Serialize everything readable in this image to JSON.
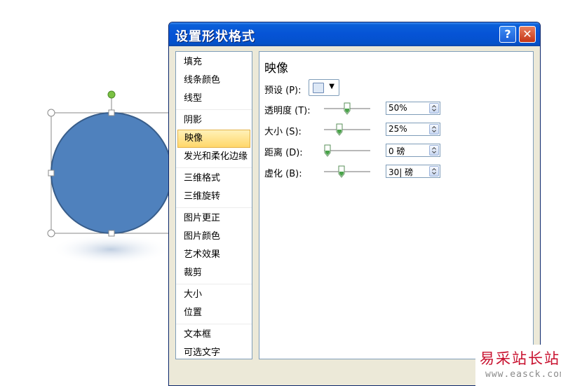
{
  "dialog": {
    "title": "设置形状格式",
    "help_label": "?",
    "close_label": "✕"
  },
  "categories": [
    [
      "填充",
      "线条颜色",
      "线型"
    ],
    [
      "阴影",
      "映像",
      "发光和柔化边缘"
    ],
    [
      "三维格式",
      "三维旋转"
    ],
    [
      "图片更正",
      "图片颜色",
      "艺术效果",
      "裁剪"
    ],
    [
      "大小",
      "位置"
    ],
    [
      "文本框",
      "可选文字"
    ]
  ],
  "active_category": "映像",
  "pane": {
    "title": "映像",
    "preset_label": "预设 (P):",
    "rows": [
      {
        "label": "透明度 (T):",
        "value": "50%",
        "slider_fraction": 0.5
      },
      {
        "label": "大小 (S):",
        "value": "25%",
        "slider_fraction": 0.3
      },
      {
        "label": "距离 (D):",
        "value": "0 磅",
        "slider_fraction": 0.0
      },
      {
        "label": "虚化 (B):",
        "value": "30| 磅",
        "slider_fraction": 0.35
      }
    ]
  },
  "colors": {
    "shape_fill": "#4f81bd",
    "shape_stroke": "#385d8a",
    "rotation_handle": "#7ac143",
    "title_bar": "#0653d6",
    "active_category_bg": "#ffd76a",
    "slider_thumb": "#4aa34a"
  },
  "watermark": {
    "main": "易采站长站",
    "sub": "www.easck.com"
  }
}
